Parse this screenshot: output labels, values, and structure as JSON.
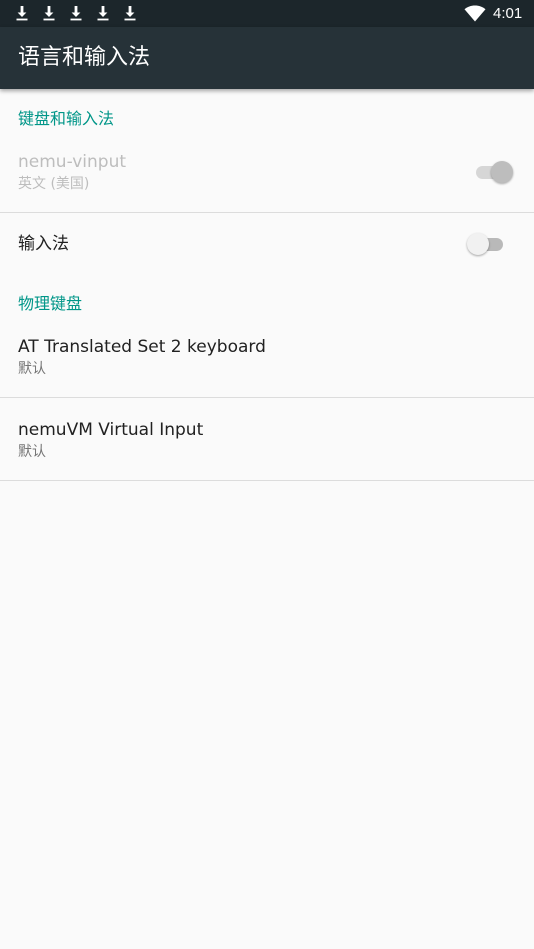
{
  "status_bar": {
    "time": "4:01",
    "icons": [
      "download-icon",
      "download-icon",
      "download-icon",
      "download-icon",
      "download-icon",
      "wifi-icon"
    ]
  },
  "toolbar": {
    "title": "语言和输入法"
  },
  "sections": {
    "keyboard_and_input": {
      "header": "键盘和输入法",
      "items": [
        {
          "title": "nemu-vinput",
          "summary": "英文 (美国)",
          "switch_on": true,
          "enabled": false
        }
      ]
    },
    "input_method": {
      "title": "输入法",
      "switch_on": false
    },
    "physical_keyboard": {
      "header": "物理键盘",
      "items": [
        {
          "title": "AT Translated Set 2 keyboard",
          "summary": "默认"
        },
        {
          "title": "nemuVM Virtual Input",
          "summary": "默认"
        }
      ]
    }
  },
  "colors": {
    "status_bar": "#1c262b",
    "toolbar": "#263238",
    "accent": "#009688",
    "background": "#fafafa"
  }
}
